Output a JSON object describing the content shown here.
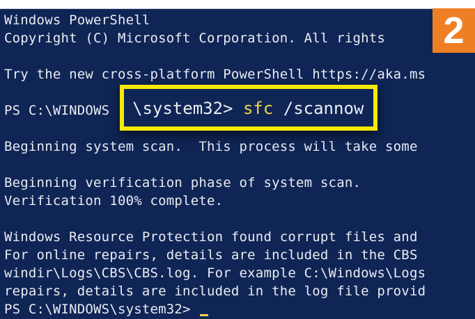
{
  "terminal": {
    "title_line": "Windows PowerShell",
    "copyright_line": "Copyright (C) Microsoft Corporation. All rights",
    "try_line": "Try the new cross-platform PowerShell https://aka.ms",
    "prompt_fragment": "PS C:\\WINDOWS",
    "scan_begin_line": "Beginning system scan.  This process will take some",
    "verify_begin_line": "Beginning verification phase of system scan.",
    "verify_complete_line": "Verification 100% complete.",
    "result_line_1": "Windows Resource Protection found corrupt files and",
    "result_line_2": "For online repairs, details are included in the CBS",
    "result_line_3": "windir\\Logs\\CBS\\CBS.log. For example C:\\Windows\\Logs",
    "result_line_4": "repairs, details are included in the log file provid",
    "final_prompt": "PS C:\\WINDOWS\\system32> "
  },
  "callout": {
    "path": "\\system32> ",
    "command": "sfc",
    "argument": " /scannow",
    "border_color": "#f5ea00"
  },
  "step_badge": {
    "number": "2",
    "color": "#ef7f25"
  },
  "colors": {
    "terminal_background": "#0f2555",
    "text": "#e9ecf2",
    "command_highlight": "#f3d34a"
  }
}
